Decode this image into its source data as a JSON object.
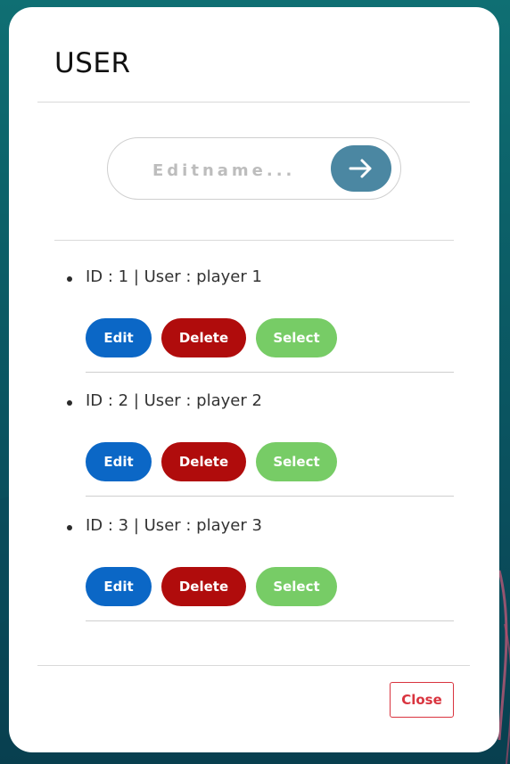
{
  "modal": {
    "title": "USER",
    "close_label": "Close"
  },
  "search": {
    "placeholder": "Editname...",
    "value": "",
    "submit_icon": "arrow-right-icon"
  },
  "users": [
    {
      "text": "ID : 1 | User : player 1",
      "edit_label": "Edit",
      "delete_label": "Delete",
      "select_label": "Select"
    },
    {
      "text": "ID : 2 | User : player 2",
      "edit_label": "Edit",
      "delete_label": "Delete",
      "select_label": "Select"
    },
    {
      "text": "ID : 3 | User : player 3",
      "edit_label": "Edit",
      "delete_label": "Delete",
      "select_label": "Select"
    }
  ],
  "colors": {
    "edit": "#0b67c6",
    "delete": "#b00c0c",
    "select": "#77cc66",
    "submit": "#4b87a2",
    "close": "#d9343f",
    "backdrop": "#0b5d66"
  }
}
